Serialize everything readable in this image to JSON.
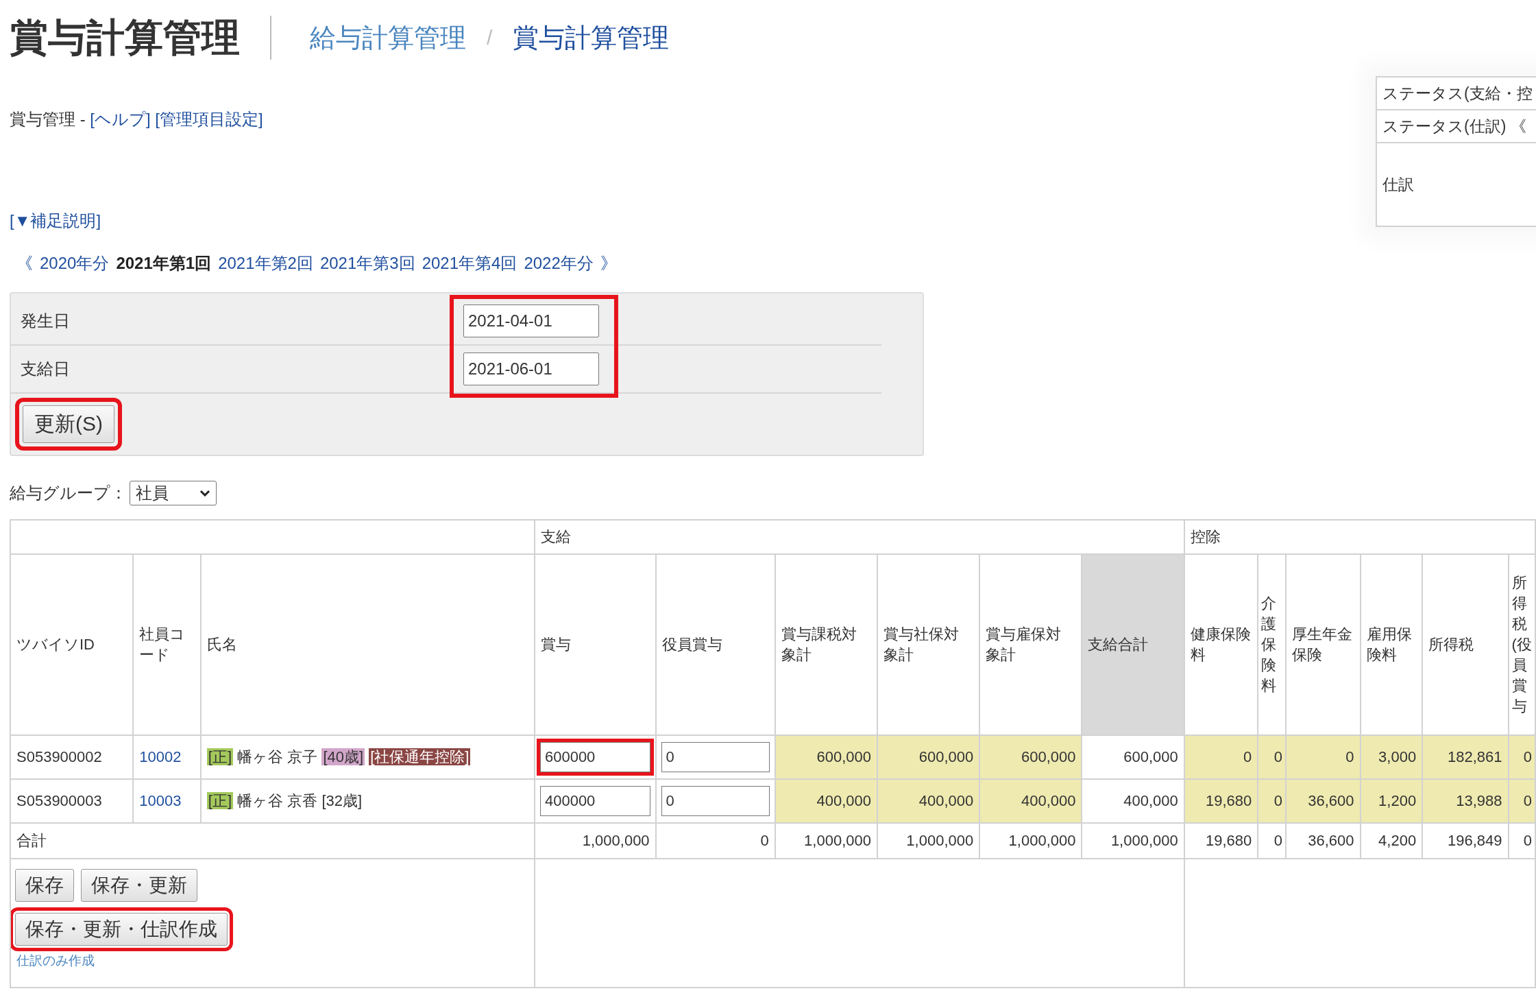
{
  "title": "賞与計算管理",
  "breadcrumb": [
    {
      "label": "給与計算管理",
      "current": false
    },
    {
      "label": "賞与計算管理",
      "current": true
    }
  ],
  "breadcrumb_separator": "/",
  "intro": {
    "text": "賞与管理 - ",
    "links": [
      "[ヘルプ]",
      "[管理項目設定]"
    ]
  },
  "supplement_link": "[▼補足説明]",
  "period_nav": {
    "prev": "《",
    "next": "》",
    "items": [
      {
        "label": "2020年分",
        "selected": false
      },
      {
        "label": "2021年第1回",
        "selected": true
      },
      {
        "label": "2021年第2回",
        "selected": false
      },
      {
        "label": "2021年第3回",
        "selected": false
      },
      {
        "label": "2021年第4回",
        "selected": false
      },
      {
        "label": "2022年分",
        "selected": false
      }
    ]
  },
  "status_panel": [
    "ステータス(支給・控",
    "ステータス(仕訳) 《",
    "仕訳"
  ],
  "date_form": {
    "highlighted": true,
    "fields": [
      {
        "label": "発生日",
        "value": "2021-04-01"
      },
      {
        "label": "支給日",
        "value": "2021-06-01"
      }
    ],
    "update_button": {
      "label": "更新(S)",
      "highlighted": true
    }
  },
  "group_filter": {
    "label": "給与グループ：",
    "value": "社員"
  },
  "table": {
    "fixed_columns": [
      "ツバイソID",
      "社員コード",
      "氏名"
    ],
    "groups": [
      {
        "label": "支給",
        "columns": [
          {
            "label": "賞与",
            "kind": "input"
          },
          {
            "label": "役員賞与",
            "kind": "input"
          },
          {
            "label": "賞与課税対象計",
            "kind": "calc"
          },
          {
            "label": "賞与社保対象計",
            "kind": "calc"
          },
          {
            "label": "賞与雇保対象計",
            "kind": "calc"
          },
          {
            "label": "支給合計",
            "kind": "total"
          }
        ]
      },
      {
        "label": "控除",
        "columns": [
          {
            "label": "健康保険料",
            "kind": "calc"
          },
          {
            "label": "介護保険料",
            "kind": "calc"
          },
          {
            "label": "厚生年金保険",
            "kind": "calc"
          },
          {
            "label": "雇用保険料",
            "kind": "calc"
          },
          {
            "label": "所得税",
            "kind": "calc"
          },
          {
            "label": "所得税(役員賞与",
            "kind": "calc"
          }
        ]
      }
    ],
    "rows": [
      {
        "id": "S053900002",
        "code": "10002",
        "name": [
          {
            "kind": "tag",
            "text": "[正]",
            "color": "#a4c95c"
          },
          {
            "kind": "text",
            "text": "幡ヶ谷 京子"
          },
          {
            "kind": "tag",
            "text": "[40歳]",
            "color": "#d2a6ca"
          },
          {
            "kind": "tag",
            "text": "[社保通年控除]",
            "color": "#8a4644"
          }
        ],
        "values": [
          {
            "value": "600000",
            "highlighted": true
          },
          {
            "value": "0",
            "highlighted": false
          },
          "600,000",
          "600,000",
          "600,000",
          "600,000",
          "0",
          "0",
          "0",
          "3,000",
          "182,861",
          "0"
        ]
      },
      {
        "id": "S053900003",
        "code": "10003",
        "name": [
          {
            "kind": "tag",
            "text": "[正]",
            "color": "#a4c95c"
          },
          {
            "kind": "text",
            "text": "幡ヶ谷 京香"
          },
          {
            "kind": "text",
            "text": "[32歳]"
          }
        ],
        "values": [
          {
            "value": "400000",
            "highlighted": false
          },
          {
            "value": "0",
            "highlighted": false
          },
          "400,000",
          "400,000",
          "400,000",
          "400,000",
          "19,680",
          "0",
          "36,600",
          "1,200",
          "13,988",
          "0"
        ]
      }
    ],
    "total": {
      "label": "合計",
      "values": [
        "1,000,000",
        "0",
        "1,000,000",
        "1,000,000",
        "1,000,000",
        "1,000,000",
        "19,680",
        "0",
        "36,600",
        "4,200",
        "196,849",
        "0"
      ]
    }
  },
  "actions": [
    {
      "label": "保存",
      "highlighted": false
    },
    {
      "label": "保存・更新",
      "highlighted": false
    },
    {
      "label": "保存・更新・仕訳作成",
      "highlighted": true
    }
  ],
  "journal_only_link": "仕訳のみ作成"
}
